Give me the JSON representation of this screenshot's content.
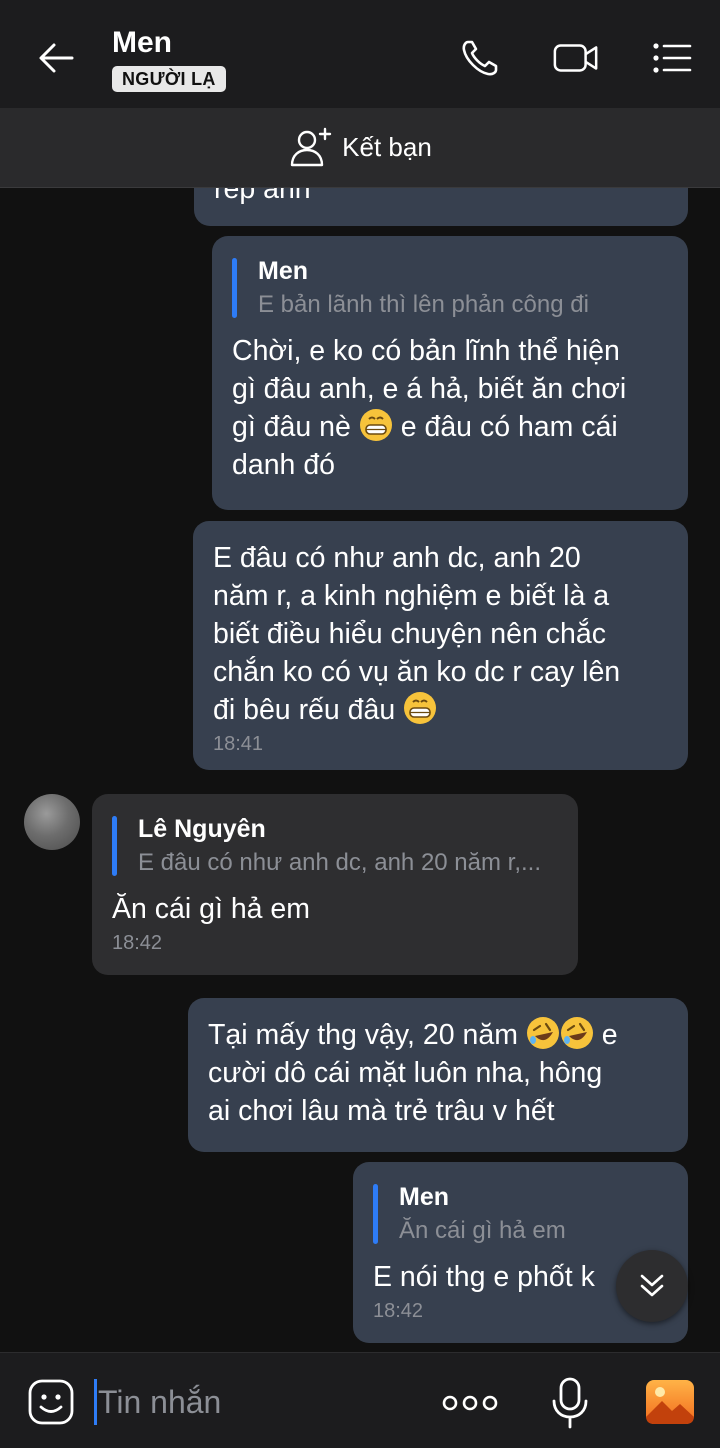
{
  "header": {
    "title": "Men",
    "badge": "NGƯỜI LẠ",
    "icons": [
      "back-arrow-icon",
      "phone-icon",
      "video-call-icon",
      "menu-list-icon"
    ]
  },
  "friend_bar": {
    "label": "Kết bạn",
    "icon": "add-friend-icon"
  },
  "messages": [
    {
      "direction": "out",
      "text": "rep anh",
      "partial": true
    },
    {
      "direction": "out",
      "quote": {
        "name": "Men",
        "text": "E bản lãnh thì lên phản công đi"
      },
      "lines": [
        "Chời, e ko có bản lĩnh thể hiện",
        "gì đâu anh, e á hả, biết ăn chơi",
        "gì đâu nè",
        "e đâu có ham cái",
        "danh đó"
      ],
      "emoji": "grinning-face"
    },
    {
      "direction": "out",
      "lines": [
        "E đâu có như anh dc, anh 20",
        "năm r, a kinh nghiệm e biết là a",
        "biết điều hiểu chuyện nên chắc",
        "chắn ko có vụ ăn ko dc r cay lên",
        "đi bêu rếu đâu"
      ],
      "emoji": "grinning-face",
      "time": "18:41"
    },
    {
      "direction": "in",
      "quote": {
        "name": "Lê Nguyên",
        "text": "E đâu có như anh dc, anh 20 năm r,..."
      },
      "text": "Ăn cái gì hả em",
      "time": "18:42"
    },
    {
      "direction": "out",
      "lines": [
        "Tại mấy thg vậy, 20 năm",
        "e",
        "cười dô cái mặt luôn nha, hông",
        "ai chơi lâu mà trẻ trâu v hết"
      ],
      "emoji": "rolling-on-floor-laughing"
    },
    {
      "direction": "out",
      "quote": {
        "name": "Men",
        "text": "Ăn cái gì hả em"
      },
      "text": "E nói thg e phốt k",
      "time": "18:42"
    }
  ],
  "composer": {
    "placeholder": "Tin nhắn",
    "icons": [
      "emoji-sticker-icon",
      "more-options-icon",
      "microphone-icon",
      "image-gallery-icon"
    ]
  },
  "colors": {
    "background": "#111111",
    "header": "#1c1c1e",
    "outgoing_bubble": "#37404f",
    "incoming_bubble": "#2e2e30",
    "quote_bar": "#2e7cf6",
    "muted_text": "#8c8f96"
  }
}
